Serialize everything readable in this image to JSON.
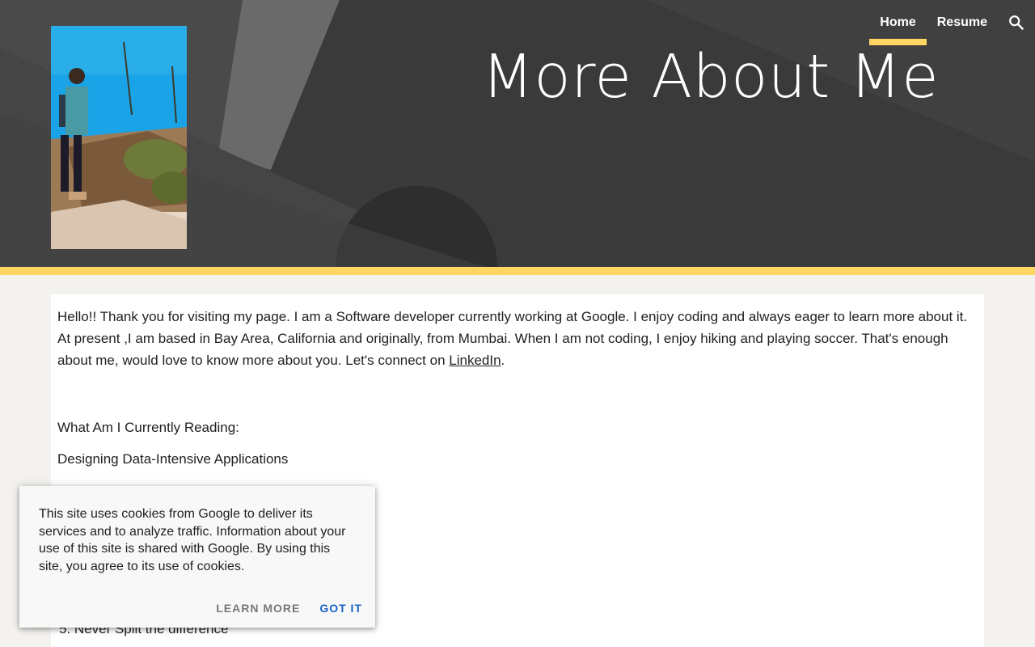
{
  "nav": {
    "items": [
      {
        "label": "Home",
        "active": true
      },
      {
        "label": "Resume",
        "active": false
      }
    ],
    "search_icon": "search-icon"
  },
  "header": {
    "title": "More About Me",
    "accent_color": "#fdd663"
  },
  "content": {
    "intro_text": "Hello!! Thank you for visiting my page. I am a Software developer currently working at Google. I enjoy coding and always eager to learn more about it. At present ,I am based in Bay Area, California and originally, from Mumbai.  When I am not coding, I enjoy hiking and playing soccer. That's enough about me, would love to know more about you. Let's connect on ",
    "link_label": "LinkedIn",
    "after_link": ".",
    "reading_label": "What Am I Currently Reading:",
    "book": "Designing Data-Intensive Applications",
    "list_item_5": "5. Never Split the difference"
  },
  "cookie": {
    "text": "This site uses cookies from Google to deliver its services and to analyze traffic. Information about your use of this site is shared with Google. By using this site, you agree to its use of cookies.",
    "learn_more": "LEARN MORE",
    "got_it": "GOT IT",
    "link_color": "#1a62c6"
  }
}
